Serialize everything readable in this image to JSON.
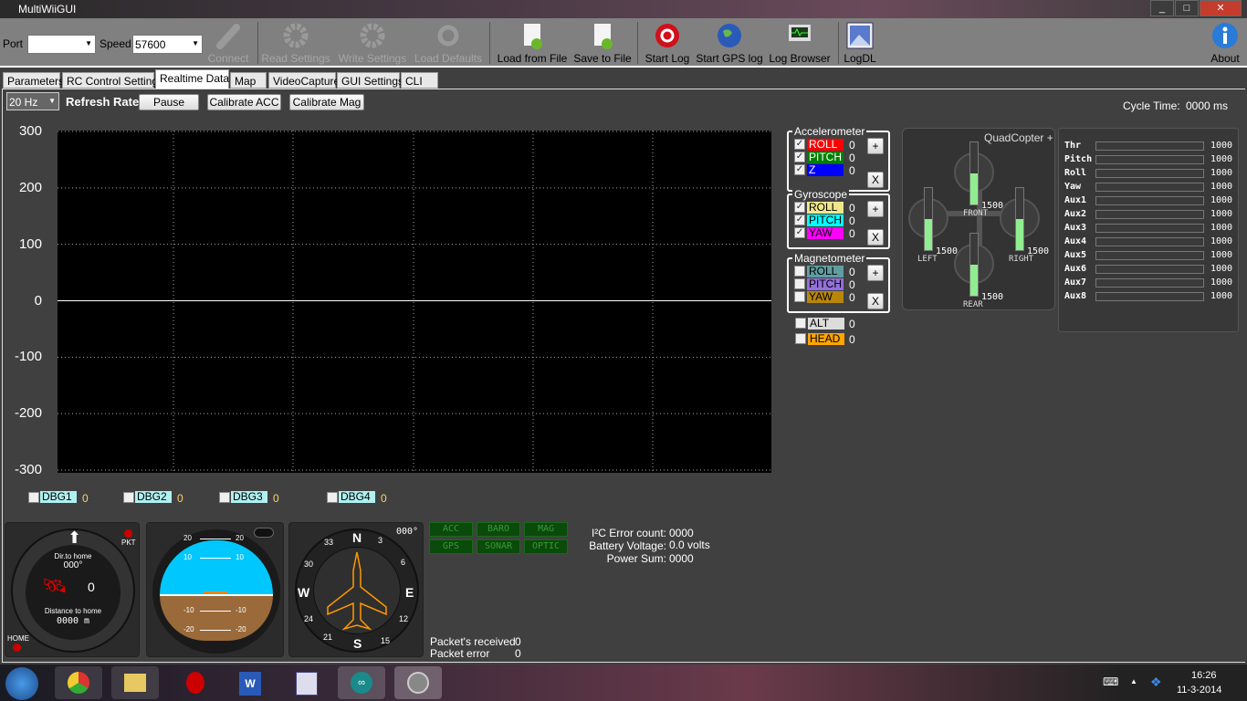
{
  "window": {
    "title": "MultiWiiGUI",
    "controls": [
      "minimize",
      "maximize",
      "close"
    ]
  },
  "toolbar": {
    "port_label": "Port",
    "port_value": "",
    "speed_label": "Speed",
    "speed_value": "57600",
    "buttons": [
      {
        "label": "Connect",
        "icon": "plug-icon",
        "enabled": false
      },
      {
        "label": "Read Settings",
        "icon": "gear-icon",
        "enabled": false
      },
      {
        "label": "Write Settings",
        "icon": "gear-icon",
        "enabled": false
      },
      {
        "label": "Load Defaults",
        "icon": "reset-icon",
        "enabled": false
      },
      {
        "label": "Load from File",
        "icon": "file-up-icon",
        "enabled": true
      },
      {
        "label": "Save to File",
        "icon": "file-down-icon",
        "enabled": true
      },
      {
        "label": "Start Log",
        "icon": "record-icon",
        "enabled": true
      },
      {
        "label": "Start GPS log",
        "icon": "globe-icon",
        "enabled": true
      },
      {
        "label": "Log Browser",
        "icon": "monitor-icon",
        "enabled": true
      },
      {
        "label": "LogDL",
        "icon": "picture-icon",
        "enabled": true
      },
      {
        "label": "About",
        "icon": "info-icon",
        "enabled": true
      }
    ]
  },
  "tabs": [
    {
      "label": "Parameters"
    },
    {
      "label": "RC Control Settings"
    },
    {
      "label": "Realtime Data",
      "active": true
    },
    {
      "label": "Map"
    },
    {
      "label": "VideoCapture"
    },
    {
      "label": "GUI Settings"
    },
    {
      "label": "CLI"
    }
  ],
  "controls": {
    "rate_value": "20 Hz",
    "rate_label": "Refresh Rate",
    "pause": "Pause",
    "cal_acc": "Calibrate ACC",
    "cal_mag": "Calibrate Mag",
    "cycle_label": "Cycle Time:",
    "cycle_value": "0000 ms"
  },
  "chart_data": {
    "type": "line",
    "ylim": [
      -300,
      300
    ],
    "yticks": [
      "300",
      "200",
      "100",
      "0",
      "-100",
      "-200",
      "-300"
    ],
    "grid": true,
    "series": [
      {
        "values": [
          0,
          0
        ]
      }
    ]
  },
  "sensors": {
    "acc": {
      "title": "Accelerometer",
      "items": [
        {
          "label": "ROLL",
          "value": "0",
          "checked": true,
          "color": "#ff0000"
        },
        {
          "label": "PITCH",
          "value": "0",
          "checked": true,
          "color": "#008000"
        },
        {
          "label": "Z",
          "value": "0",
          "checked": true,
          "color": "#0000ff"
        }
      ]
    },
    "gyro": {
      "title": "Gyroscope",
      "items": [
        {
          "label": "ROLL",
          "value": "0",
          "checked": true,
          "color": "#f0e68c"
        },
        {
          "label": "PITCH",
          "value": "0",
          "checked": true,
          "color": "#00ffff"
        },
        {
          "label": "YAW",
          "value": "0",
          "checked": true,
          "color": "#ff00ff"
        }
      ]
    },
    "mag": {
      "title": "Magnetometer",
      "items": [
        {
          "label": "ROLL",
          "value": "0",
          "checked": false,
          "color": "#5f9ea0"
        },
        {
          "label": "PITCH",
          "value": "0",
          "checked": false,
          "color": "#9370db"
        },
        {
          "label": "YAW",
          "value": "0",
          "checked": false,
          "color": "#b8860b"
        }
      ]
    },
    "alt": {
      "label": "ALT",
      "value": "0",
      "checked": false,
      "color": "#dcdcdc"
    },
    "head": {
      "label": "HEAD",
      "value": "0",
      "checked": false,
      "color": "#ffa500"
    },
    "plus": "+",
    "x": "X"
  },
  "quad": {
    "title": "QuadCopter +",
    "motors": [
      {
        "label": "FRONT",
        "value": "1500",
        "level": 0.5
      },
      {
        "label": "LEFT",
        "value": "1500",
        "level": 0.5
      },
      {
        "label": "RIGHT",
        "value": "1500",
        "level": 0.5
      },
      {
        "label": "REAR",
        "value": "1500",
        "level": 0.5
      }
    ]
  },
  "rc": [
    {
      "label": "Thr",
      "value": "1000"
    },
    {
      "label": "Pitch",
      "value": "1000"
    },
    {
      "label": "Roll",
      "value": "1000"
    },
    {
      "label": "Yaw",
      "value": "1000"
    },
    {
      "label": "Aux1",
      "value": "1000"
    },
    {
      "label": "Aux2",
      "value": "1000"
    },
    {
      "label": "Aux3",
      "value": "1000"
    },
    {
      "label": "Aux4",
      "value": "1000"
    },
    {
      "label": "Aux5",
      "value": "1000"
    },
    {
      "label": "Aux6",
      "value": "1000"
    },
    {
      "label": "Aux7",
      "value": "1000"
    },
    {
      "label": "Aux8",
      "value": "1000"
    }
  ],
  "debug": [
    {
      "label": "DBG1",
      "value": "0"
    },
    {
      "label": "DBG2",
      "value": "0"
    },
    {
      "label": "DBG3",
      "value": "0"
    },
    {
      "label": "DBG4",
      "value": "0"
    }
  ],
  "home": {
    "pkt": "PKT",
    "dir_label": "Dir.to home",
    "dir_value": "000°",
    "sats": "0",
    "dist_label": "Distance to home",
    "dist_value": "0000 m",
    "home": "HOME"
  },
  "horizon": {
    "pitch_labels": [
      "20",
      "10",
      "-10",
      "-20"
    ]
  },
  "compass": {
    "heading": "000°",
    "n": "N",
    "e": "E",
    "s": "S",
    "w": "W",
    "marks": [
      "3",
      "6",
      "12",
      "15",
      "21",
      "24",
      "30",
      "33"
    ]
  },
  "status_leds": [
    "ACC",
    "BARO",
    "MAG",
    "GPS",
    "SONAR",
    "OPTIC"
  ],
  "stats": {
    "i2c_label": "I²C Error count:",
    "i2c_value": "0000",
    "batt_label": "Battery Voltage:",
    "batt_value": "0.0 volts",
    "power_label": "Power Sum:",
    "power_value": "0000",
    "pkt_rx_label": "Packet's received",
    "pkt_rx_value": "0",
    "pkt_err_label": "Packet error",
    "pkt_err_value": "0"
  },
  "taskbar": {
    "apps": [
      "start",
      "chrome",
      "explorer",
      "app-red",
      "word",
      "network-app",
      "arduino",
      "app-gray"
    ],
    "time": "16:26",
    "date": "11-3-2014"
  }
}
